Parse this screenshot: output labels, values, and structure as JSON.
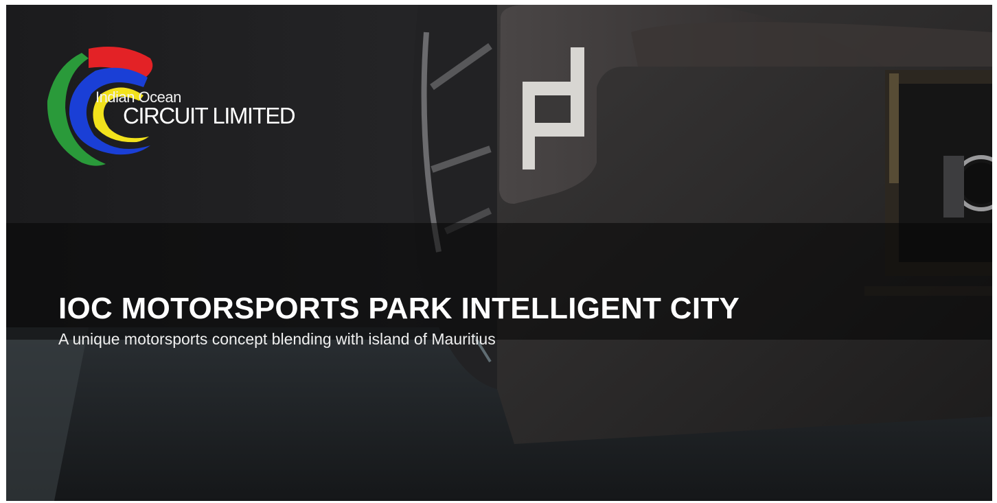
{
  "logo": {
    "line1": "Indian Ocean",
    "line2": "CIRCUIT LIMITED",
    "colors": {
      "red": "#e32226",
      "blue": "#1a3fd6",
      "green": "#2a9a3a",
      "yellow": "#f2e21c"
    }
  },
  "hero": {
    "title": "IOC MOTORSPORTS PARK INTELLIGENT CITY",
    "subtitle": "A unique motorsports concept blending with island of Mauritius",
    "background": "race-car-rear-photo",
    "car_badge": "P"
  }
}
